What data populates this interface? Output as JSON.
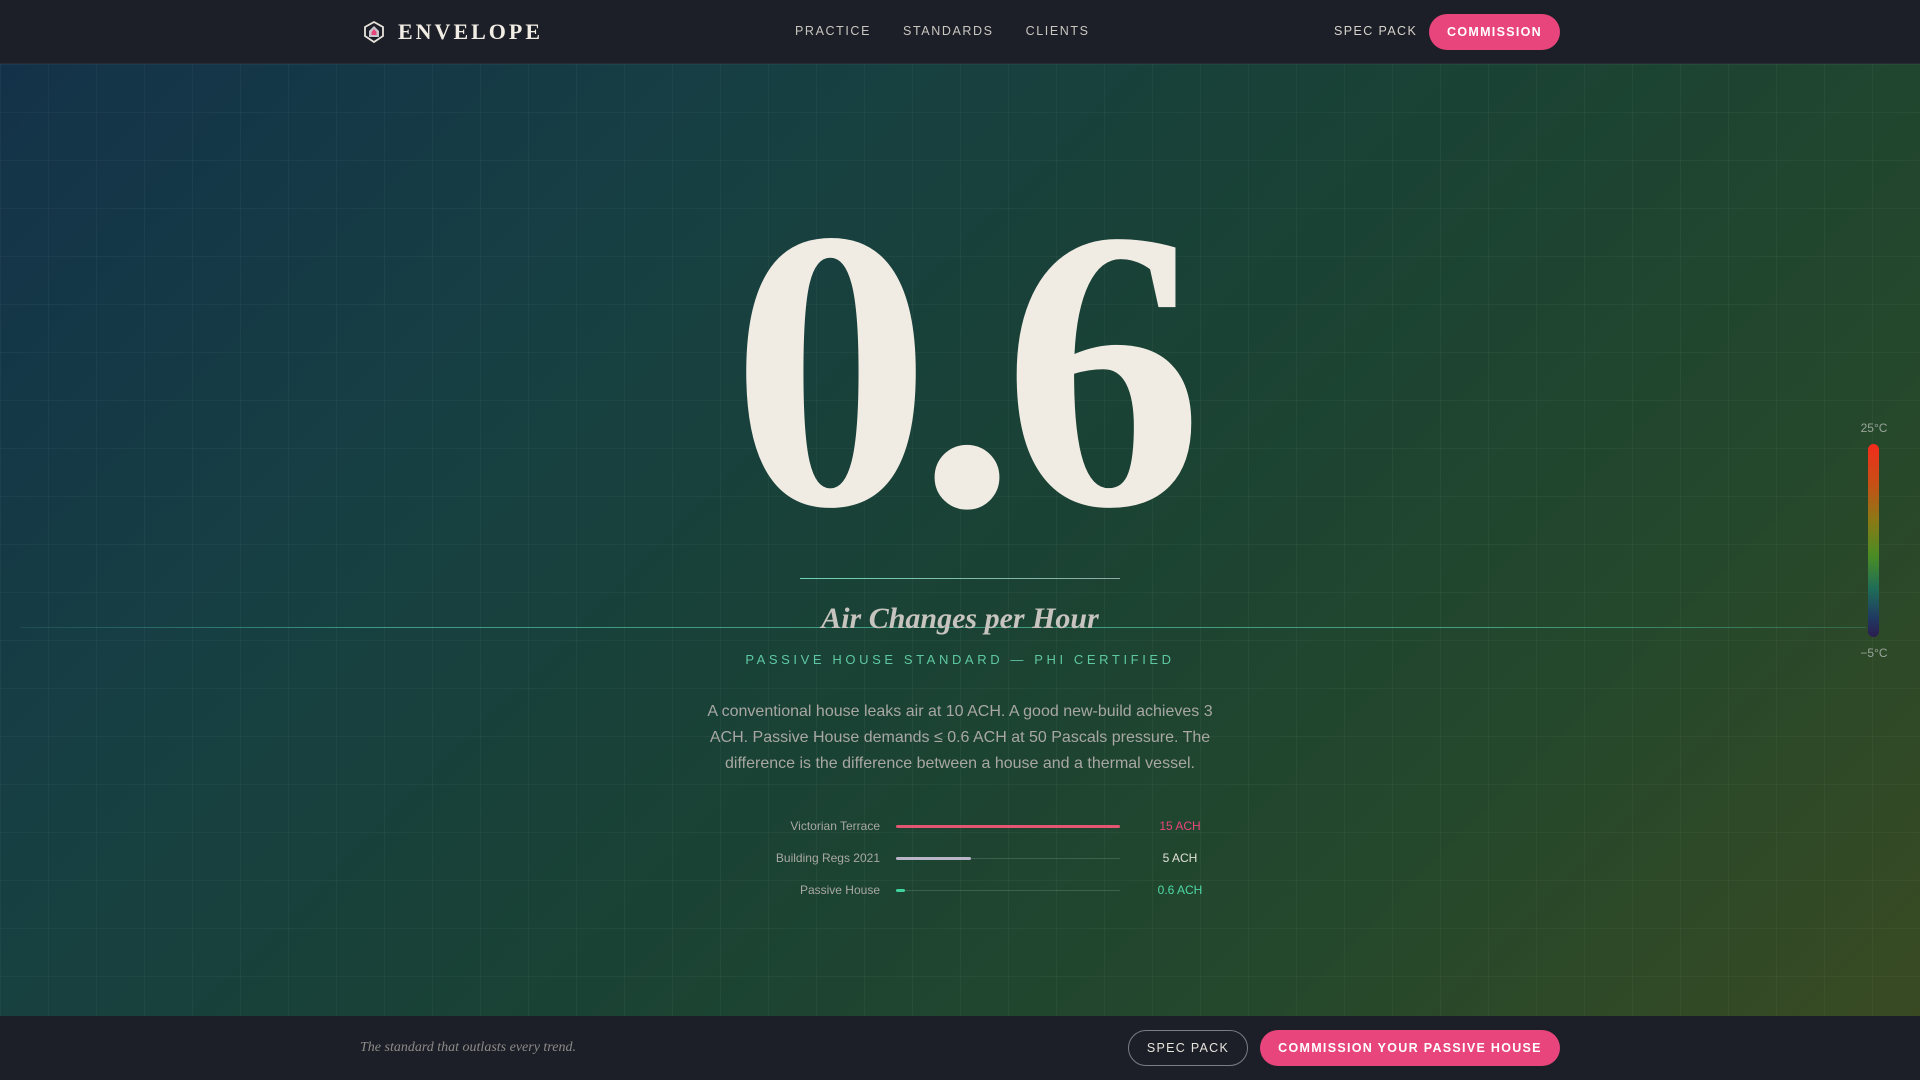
{
  "header": {
    "brand_icon": "house-shield-icon",
    "brand_name": "ENVELOPE",
    "nav": [
      {
        "label": "PRACTICE"
      },
      {
        "label": "STANDARDS"
      },
      {
        "label": "CLIENTS"
      }
    ],
    "spec_pack_label": "SPEC PACK",
    "commission_label": "COMMISSION"
  },
  "hero": {
    "value": "0.6",
    "unit_title": "Air Changes per Hour",
    "kicker": "PASSIVE HOUSE STANDARD — PHI CERTIFIED",
    "description": "A conventional house leaks air at 10 ACH. A good new-build achieves 3 ACH. Passive House demands ≤ 0.6 ACH at 50 Pascals pressure. The difference is the difference between a house and a thermal vessel."
  },
  "comparison": {
    "max_ach": 15,
    "rows": [
      {
        "label": "Victorian Terrace",
        "ach": 15,
        "value_text": "15 ACH",
        "color": "#e8457c",
        "fill_color": "#e25672"
      },
      {
        "label": "Building Regs 2021",
        "ach": 5,
        "value_text": "5 ACH",
        "color": "#e3e0da",
        "fill_color": "#b9b6c9"
      },
      {
        "label": "Passive House",
        "ach": 0.6,
        "value_text": "0.6 ACH",
        "color": "#4fd8a7",
        "fill_color": "#3fd29c"
      }
    ]
  },
  "thermometer": {
    "icon": "temperature-scale",
    "top_label": "25°C",
    "bottom_label": "−5°C"
  },
  "footer": {
    "tagline": "The standard that outlasts every trend.",
    "spec_pack_label": "SPEC PACK",
    "cta_label": "COMMISSION YOUR PASSIVE HOUSE"
  },
  "colors": {
    "accent": "#e8457c",
    "teal": "#5ec8a3",
    "bar_bg": "#1c1f27",
    "text": "#f0ebe3"
  }
}
